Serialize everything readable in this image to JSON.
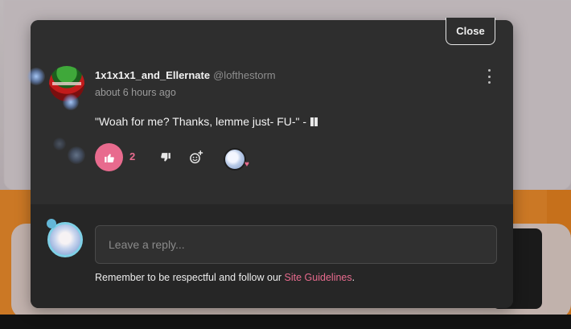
{
  "modal": {
    "close_label": "Close"
  },
  "comment": {
    "username": "1x1x1x1_and_Ellernate",
    "handle": "@lofthestorm",
    "timestamp": "about 6 hours ago",
    "text": "\"Woah for me? Thanks, lemme just- FU-\" -",
    "like_count": "2",
    "icons": {
      "more": "kebab-menu-icon",
      "like": "thumbs-up-icon",
      "dislike": "thumbs-down-icon",
      "react": "add-reaction-icon",
      "heart": "heart-icon"
    },
    "reaction_heart": "♥"
  },
  "reply": {
    "placeholder": "Leave a reply...",
    "notice_prefix": "Remember to be respectful and follow our ",
    "guidelines_link": "Site Guidelines",
    "notice_suffix": "."
  },
  "colors": {
    "accent": "#e86b8e",
    "modal_bg": "#2e2e2e",
    "modal_footer_bg": "#262626",
    "page_orange": "#e7862a"
  }
}
